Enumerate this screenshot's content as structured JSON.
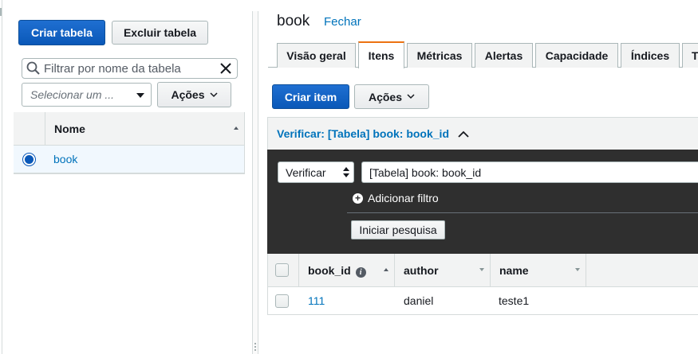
{
  "left": {
    "create_table_label": "Criar tabela",
    "delete_table_label": "Excluir tabela",
    "search_placeholder": "Filtrar por nome da tabela",
    "select_placeholder": "Selecionar um ...",
    "actions_label": "Ações",
    "table": {
      "header": "Nome",
      "rows": [
        {
          "name": "book",
          "selected": true
        }
      ]
    }
  },
  "right": {
    "title": "book",
    "close_label": "Fechar",
    "tabs": [
      {
        "label": "Visão geral",
        "active": false
      },
      {
        "label": "Itens",
        "active": true
      },
      {
        "label": "Métricas",
        "active": false
      },
      {
        "label": "Alertas",
        "active": false
      },
      {
        "label": "Capacidade",
        "active": false
      },
      {
        "label": "Índices",
        "active": false
      },
      {
        "label": "T",
        "active": false
      }
    ],
    "create_item_label": "Criar item",
    "actions_label": "Ações",
    "filter": {
      "header": "Verificar: [Tabela] book: book_id",
      "mode": "Verificar",
      "target": "[Tabela] book: book_id",
      "add_filter_label": "Adicionar filtro",
      "search_button_label": "Iniciar pesquisa"
    },
    "items_table": {
      "columns": [
        "book_id",
        "author",
        "name"
      ],
      "rows": [
        {
          "book_id": "111",
          "author": "daniel",
          "name": "teste1"
        }
      ]
    }
  },
  "colors": {
    "primary": "#0a58b8",
    "link": "#0073bb",
    "active_tab": "#ec7211",
    "dark_panel": "#2f2f2f"
  }
}
